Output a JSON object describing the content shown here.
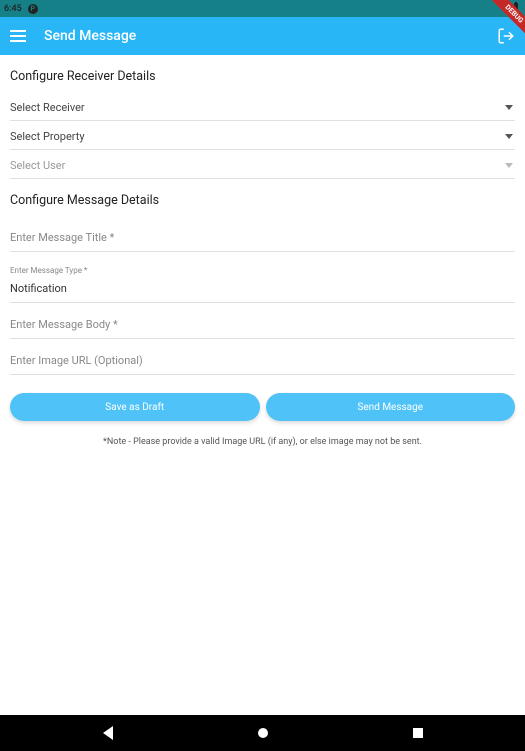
{
  "status": {
    "time": "6:45",
    "debug_label": "DEBUG"
  },
  "appbar": {
    "title": "Send Message"
  },
  "sections": {
    "receiver_heading": "Configure Receiver Details",
    "message_heading": "Configure Message Details"
  },
  "dropdowns": {
    "receiver": "Select Receiver",
    "property": "Select Property",
    "user": "Select User"
  },
  "fields": {
    "title_placeholder": "Enter Message Title *",
    "type_label": "Enter Message Type *",
    "type_value": "Notification",
    "body_placeholder": "Enter Message Body *",
    "image_placeholder": "Enter Image URL (Optional)"
  },
  "buttons": {
    "draft": "Save as Draft",
    "send": "Send Message"
  },
  "note": "*Note - Please provide a valid Image URL (if any), or else image may not be sent."
}
